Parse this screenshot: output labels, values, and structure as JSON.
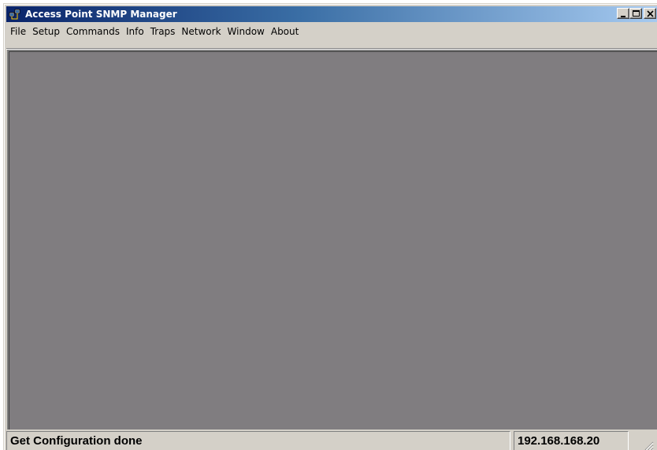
{
  "window": {
    "title": "Access Point SNMP Manager",
    "icon": "network-computers-icon",
    "buttons": {
      "minimize": "minimize-icon",
      "maximize": "maximize-icon",
      "close": "close-icon"
    }
  },
  "menu": {
    "items": [
      "File",
      "Setup",
      "Commands",
      "Info",
      "Traps",
      "Network",
      "Window",
      "About"
    ]
  },
  "client": {
    "background": "#807d80"
  },
  "status": {
    "message": "Get Configuration done",
    "ip": "192.168.168.20"
  },
  "colors": {
    "titlebar_start": "#0a246a",
    "titlebar_end": "#a6caf0",
    "chrome": "#d4d0c8"
  }
}
